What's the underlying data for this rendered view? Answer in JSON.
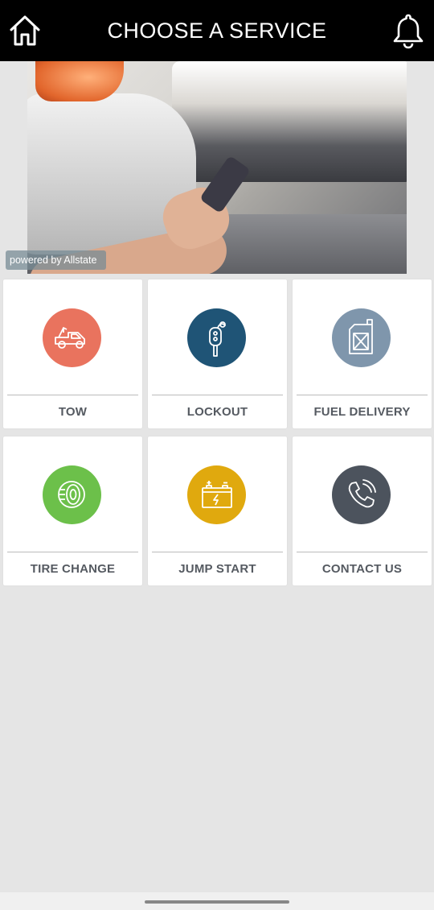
{
  "header": {
    "title": "CHOOSE A SERVICE",
    "home_icon": "home-icon",
    "bell_icon": "bell-icon"
  },
  "hero": {
    "badge": "powered by Allstate"
  },
  "services": [
    {
      "label": "TOW",
      "icon": "tow-truck-icon",
      "color": "#e9735e"
    },
    {
      "label": "LOCKOUT",
      "icon": "car-key-icon",
      "color": "#1f5476"
    },
    {
      "label": "FUEL DELIVERY",
      "icon": "fuel-can-icon",
      "color": "#7f96ac"
    },
    {
      "label": "TIRE CHANGE",
      "icon": "tire-icon",
      "color": "#6cc04a"
    },
    {
      "label": "JUMP START",
      "icon": "battery-icon",
      "color": "#e0a90e"
    },
    {
      "label": "CONTACT US",
      "icon": "phone-icon",
      "color": "#4c535d"
    }
  ]
}
